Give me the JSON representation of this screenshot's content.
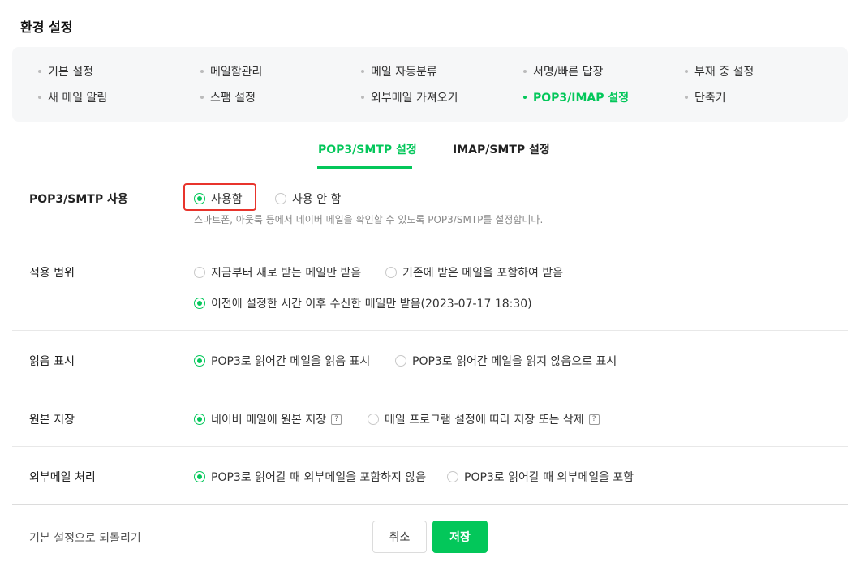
{
  "page_title": "환경 설정",
  "menu": [
    [
      "기본 설정",
      "메일함관리",
      "메일 자동분류",
      "서명/빠른 답장",
      "부재 중 설정"
    ],
    [
      "새 메일 알림",
      "스팸 설정",
      "외부메일 가져오기",
      "POP3/IMAP 설정",
      "단축키"
    ]
  ],
  "active_menu": "POP3/IMAP 설정",
  "tabs": {
    "pop3": "POP3/SMTP 설정",
    "imap": "IMAP/SMTP 설정",
    "active": "POP3/SMTP 설정"
  },
  "rows": {
    "use": {
      "label": "POP3/SMTP 사용",
      "options": [
        "사용함",
        "사용 안 함"
      ],
      "selected": "사용함",
      "description": "스마트폰, 아웃룩 등에서 네이버 메일을 확인할 수 있도록 POP3/SMTP를 설정합니다."
    },
    "scope": {
      "label": "적용 범위",
      "options": [
        "지금부터 새로 받는 메일만 받음",
        "기존에 받은 메일을 포함하여 받음",
        "이전에 설정한 시간 이후 수신한 메일만 받음(2023-07-17 18:30)"
      ],
      "selected": "이전에 설정한 시간 이후 수신한 메일만 받음(2023-07-17 18:30)"
    },
    "read": {
      "label": "읽음 표시",
      "options": [
        "POP3로 읽어간 메일을 읽음 표시",
        "POP3로 읽어간 메일을 읽지 않음으로 표시"
      ],
      "selected": "POP3로 읽어간 메일을 읽음 표시"
    },
    "original": {
      "label": "원본 저장",
      "options": [
        "네이버 메일에 원본 저장",
        "메일 프로그램 설정에 따라 저장 또는 삭제"
      ],
      "selected": "네이버 메일에 원본 저장",
      "help": "?"
    },
    "external": {
      "label": "외부메일 처리",
      "options": [
        "POP3로 읽어갈 때 외부메일을 포함하지 않음",
        "POP3로 읽어갈 때 외부메일을 포함"
      ],
      "selected": "POP3로 읽어갈 때 외부메일을 포함하지 않음"
    }
  },
  "footer": {
    "reset": "기본 설정으로 되돌리기",
    "cancel": "취소",
    "save": "저장"
  },
  "colors": {
    "accent": "#03c75a",
    "highlight": "#e8342c"
  },
  "icons": {
    "radio_checked": "radio-checked-icon",
    "radio_unchecked": "radio-unchecked-icon",
    "help": "help-icon"
  }
}
